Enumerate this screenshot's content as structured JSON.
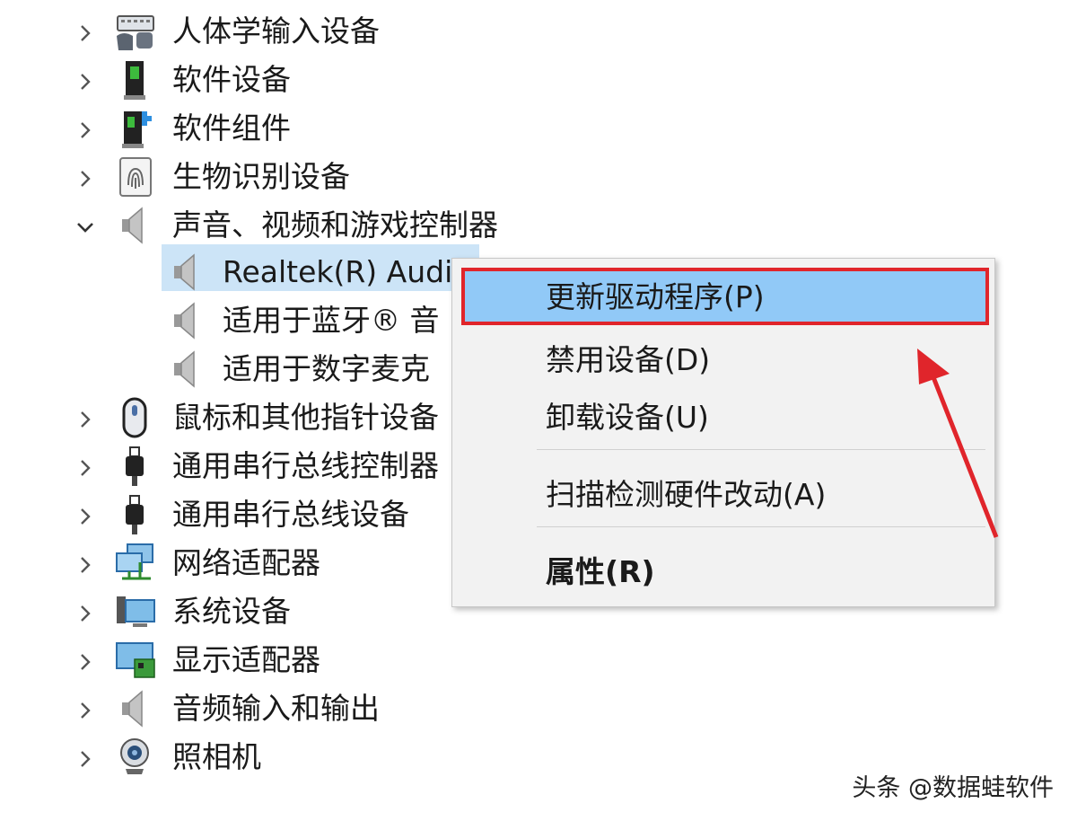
{
  "tree": {
    "items": [
      {
        "label": "人体学输入设备",
        "icon": "hid-keyboard-icon",
        "expanded": false
      },
      {
        "label": "软件设备",
        "icon": "software-device-icon",
        "expanded": false
      },
      {
        "label": "软件组件",
        "icon": "software-component-icon",
        "expanded": false
      },
      {
        "label": "生物识别设备",
        "icon": "fingerprint-icon",
        "expanded": false
      },
      {
        "label": "声音、视频和游戏控制器",
        "icon": "speaker-icon",
        "expanded": true
      },
      {
        "label": "Realtek(R) Audi",
        "icon": "speaker-icon",
        "child": true,
        "selected": true
      },
      {
        "label": "适用于蓝牙® 音",
        "icon": "speaker-icon",
        "child": true
      },
      {
        "label": "适用于数字麦克",
        "icon": "speaker-icon",
        "child": true
      },
      {
        "label": "鼠标和其他指针设备",
        "icon": "mouse-icon",
        "expanded": false
      },
      {
        "label": "通用串行总线控制器",
        "icon": "usb-plug-icon",
        "expanded": false
      },
      {
        "label": "通用串行总线设备",
        "icon": "usb-plug-icon",
        "expanded": false
      },
      {
        "label": "网络适配器",
        "icon": "network-adapter-icon",
        "expanded": false
      },
      {
        "label": "系统设备",
        "icon": "system-device-icon",
        "expanded": false
      },
      {
        "label": "显示适配器",
        "icon": "display-adapter-icon",
        "expanded": false
      },
      {
        "label": "音频输入和输出",
        "icon": "speaker-icon",
        "expanded": false
      },
      {
        "label": "照相机",
        "icon": "webcam-icon",
        "expanded": false
      }
    ]
  },
  "context_menu": {
    "items": [
      {
        "label": "更新驱动程序(P)",
        "highlighted": true
      },
      {
        "label": "禁用设备(D)"
      },
      {
        "label": "卸载设备(U)"
      },
      {
        "label": "扫描检测硬件改动(A)"
      },
      {
        "label": "属性(R)",
        "bold": true
      }
    ]
  },
  "annotation": {
    "arrow_color": "#e0252b",
    "highlight_border": "#e0252b"
  },
  "watermark": "头条 @数据蛙软件",
  "colors": {
    "selection": "#cce4f7",
    "menu_highlight": "#91c9f7",
    "menu_bg": "#f2f2f2"
  }
}
